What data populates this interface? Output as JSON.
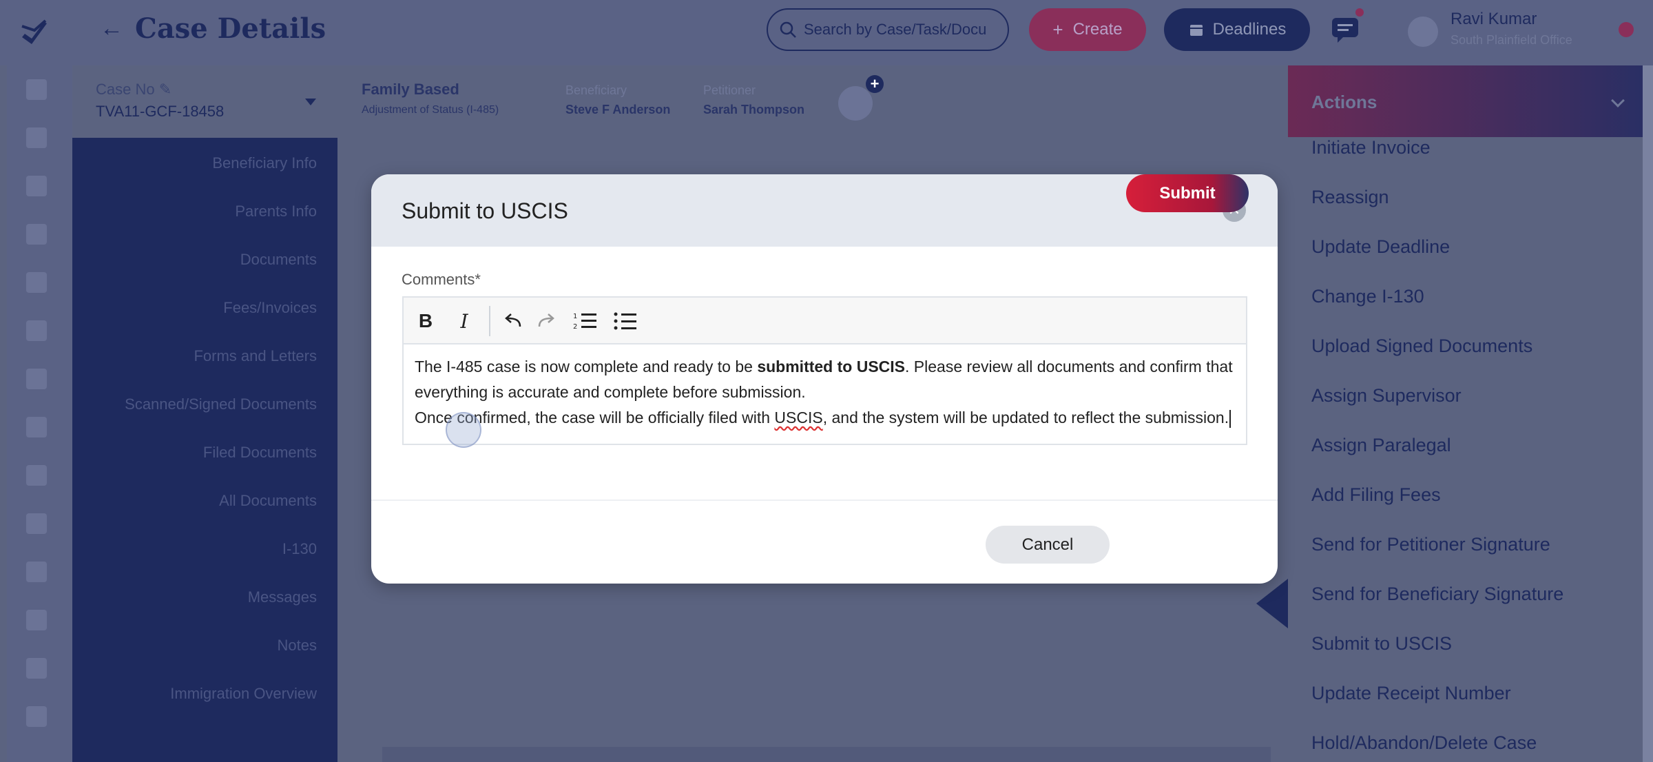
{
  "header": {
    "title": "Case Details",
    "search_placeholder": "Search by Case/Task/Docu",
    "create_label": "Create",
    "deadlines_label": "Deadlines",
    "user_name": "Ravi Kumar",
    "user_office": "South Plainfield Office"
  },
  "case": {
    "case_no_label": "Case No",
    "case_no": "TVA11-GCF-18458",
    "type_title": "Family Based",
    "type_sub": "Adjustment of Status (I-485)",
    "beneficiary_label": "Beneficiary",
    "beneficiary": "Steve F Anderson",
    "petitioner_label": "Petitioner",
    "petitioner": "Sarah Thompson"
  },
  "nav": {
    "items": [
      "Beneficiary Info",
      "Parents Info",
      "Documents",
      "Fees/Invoices",
      "Forms and Letters",
      "Scanned/Signed Documents",
      "Filed Documents",
      "All Documents",
      "I-130",
      "Messages",
      "Notes",
      "Immigration Overview"
    ]
  },
  "actions": {
    "title": "Actions",
    "items": [
      "Initiate Invoice",
      "Reassign",
      "Update Deadline",
      "Change I-130",
      "Upload Signed Documents",
      "Assign Supervisor",
      "Assign Paralegal",
      "Add Filing Fees",
      "Send for Petitioner Signature",
      "Send for Beneficiary Signature",
      "Submit to USCIS",
      "Update Receipt Number",
      "Hold/Abandon/Delete Case"
    ]
  },
  "modal": {
    "title": "Submit to USCIS",
    "comments_label": "Comments*",
    "text_part1": "The I-485 case is now complete and ready to be ",
    "text_bold": "submitted to USCIS",
    "text_part2": ". Please review all documents and confirm that everything is accurate and complete before submission.",
    "text_line2_part1": "Once confirmed, the case will be officially filed with ",
    "text_line2_uscis": "USCIS",
    "text_line2_part2": ", and the system will be updated to reflect the submission.",
    "cancel_label": "Cancel",
    "submit_label": "Submit"
  },
  "colors": {
    "navy": "#1e2a5e",
    "overlay": "#5b6380",
    "submit_red": "#d61f3a"
  }
}
